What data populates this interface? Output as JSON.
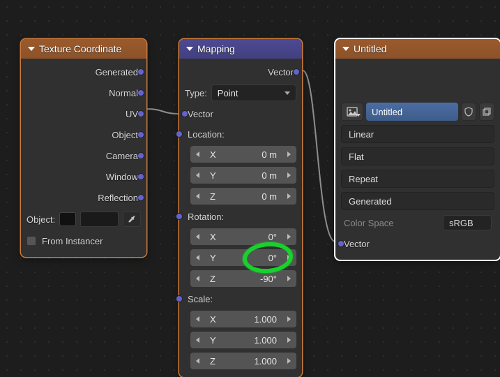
{
  "nodes": {
    "texcoord": {
      "title": "Texture Coordinate",
      "outputs": [
        "Generated",
        "Normal",
        "UV",
        "Object",
        "Camera",
        "Window",
        "Reflection"
      ],
      "object_label": "Object:",
      "from_instancer": "From Instancer"
    },
    "mapping": {
      "title": "Mapping",
      "out_vector": "Vector",
      "type_label": "Type:",
      "type_value": "Point",
      "in_vector": "Vector",
      "location_label": "Location:",
      "location": {
        "x_label": "X",
        "y_label": "Y",
        "z_label": "Z",
        "x": "0 m",
        "y": "0 m",
        "z": "0 m"
      },
      "rotation_label": "Rotation:",
      "rotation": {
        "x_label": "X",
        "y_label": "Y",
        "z_label": "Z",
        "x": "0°",
        "y": "0°",
        "z": "-90°"
      },
      "scale_label": "Scale:",
      "scale": {
        "x_label": "X",
        "y_label": "Y",
        "z_label": "Z",
        "x": "1.000",
        "y": "1.000",
        "z": "1.000"
      }
    },
    "imgtex": {
      "title": "Untitled",
      "image_name": "Untitled",
      "interpolation": "Linear",
      "projection": "Flat",
      "extension": "Repeat",
      "source": "Generated",
      "colorspace_label": "Color Space",
      "colorspace_value": "sRGB",
      "in_vector": "Vector"
    }
  }
}
